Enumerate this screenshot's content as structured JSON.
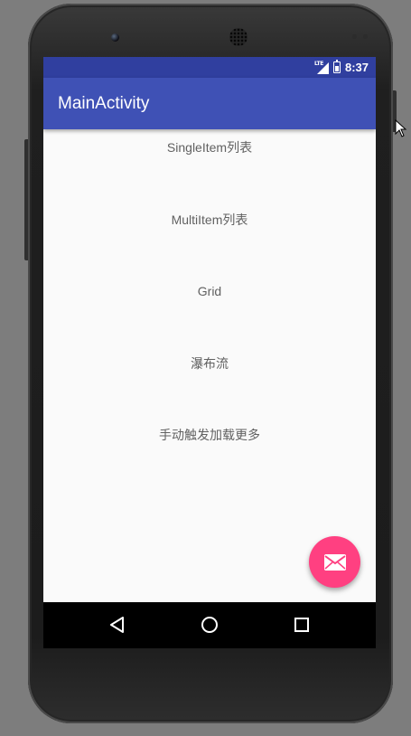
{
  "status_bar": {
    "network_label": "LTE",
    "time": "8:37",
    "icons": [
      "signal-icon",
      "battery-icon"
    ]
  },
  "toolbar": {
    "title": "MainActivity"
  },
  "menu": {
    "items": [
      {
        "label": "SingleItem列表"
      },
      {
        "label": "MultiItem列表"
      },
      {
        "label": "Grid"
      },
      {
        "label": "瀑布流"
      },
      {
        "label": "手动触发加载更多"
      }
    ]
  },
  "fab": {
    "icon": "mail-icon"
  },
  "nav_bar": {
    "icons": [
      "back-icon",
      "home-icon",
      "recents-icon"
    ]
  },
  "colors": {
    "primary": "#3f51b5",
    "primary_dark": "#303f9f",
    "accent": "#ff4081",
    "background": "#fafafa",
    "text": "#616161"
  }
}
